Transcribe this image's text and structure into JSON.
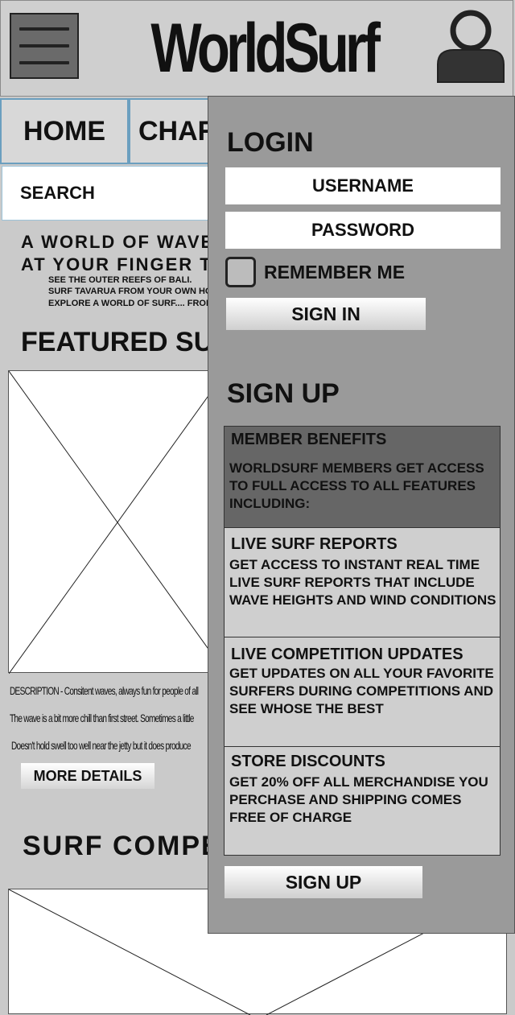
{
  "header": {
    "title": "WorldSurf",
    "menu_icon": "hamburger-menu-icon",
    "profile_icon": "user-avatar-icon"
  },
  "tabs": [
    {
      "label": "HOME"
    },
    {
      "label": "CHARTS"
    }
  ],
  "search": {
    "placeholder": "SEARCH"
  },
  "hero": {
    "line1": "A WORLD OF WAVES",
    "line2": "AT YOUR FINGER TIPS",
    "sub1": "SEE THE OUTER REEFS OF BALI.",
    "sub2": "SURF TAVARUA FROM YOUR OWN HOME.",
    "sub3": "EXPLORE A WORLD OF SURF.... FROM"
  },
  "featured": {
    "title": "FEATURED SURF",
    "desc1": "DESCRIPTION - Consitent waves, always fun for people of all",
    "desc2": "The wave is a bit more chill than first street. Sometimes a little",
    "desc3": "Doesn't hold swell too well near the jetty but it does produce",
    "more_button": "MORE DETAILS"
  },
  "competitions": {
    "title": "SURF COMPETITIONS"
  },
  "panel": {
    "login_heading": "LOGIN",
    "username_placeholder": "USERNAME",
    "password_placeholder": "PASSWORD",
    "remember_label": "REMEMBER ME",
    "signin_button": "SIGN IN",
    "signup_heading": "SIGN UP",
    "benefits": {
      "title": "MEMBER BENEFITS",
      "body": "WORLDSURF MEMBERS GET ACCESS TO FULL ACCESS TO ALL FEATURES INCLUDING:"
    },
    "cards": [
      {
        "title": "LIVE SURF REPORTS",
        "body": "GET ACCESS TO INSTANT REAL TIME LIVE SURF REPORTS THAT INCLUDE WAVE HEIGHTS AND WIND CONDITIONS"
      },
      {
        "title": "LIVE COMPETITION UPDATES",
        "body": "GET UPDATES ON ALL YOUR FAVORITE SURFERS DURING COMPETITIONS AND SEE WHOSE THE BEST"
      },
      {
        "title": "STORE DISCOUNTS",
        "body": "GET 20% OFF ALL MERCHANDISE YOU PERCHASE AND SHIPPING COMES FREE OF CHARGE"
      }
    ],
    "signup_button": "SIGN UP"
  }
}
